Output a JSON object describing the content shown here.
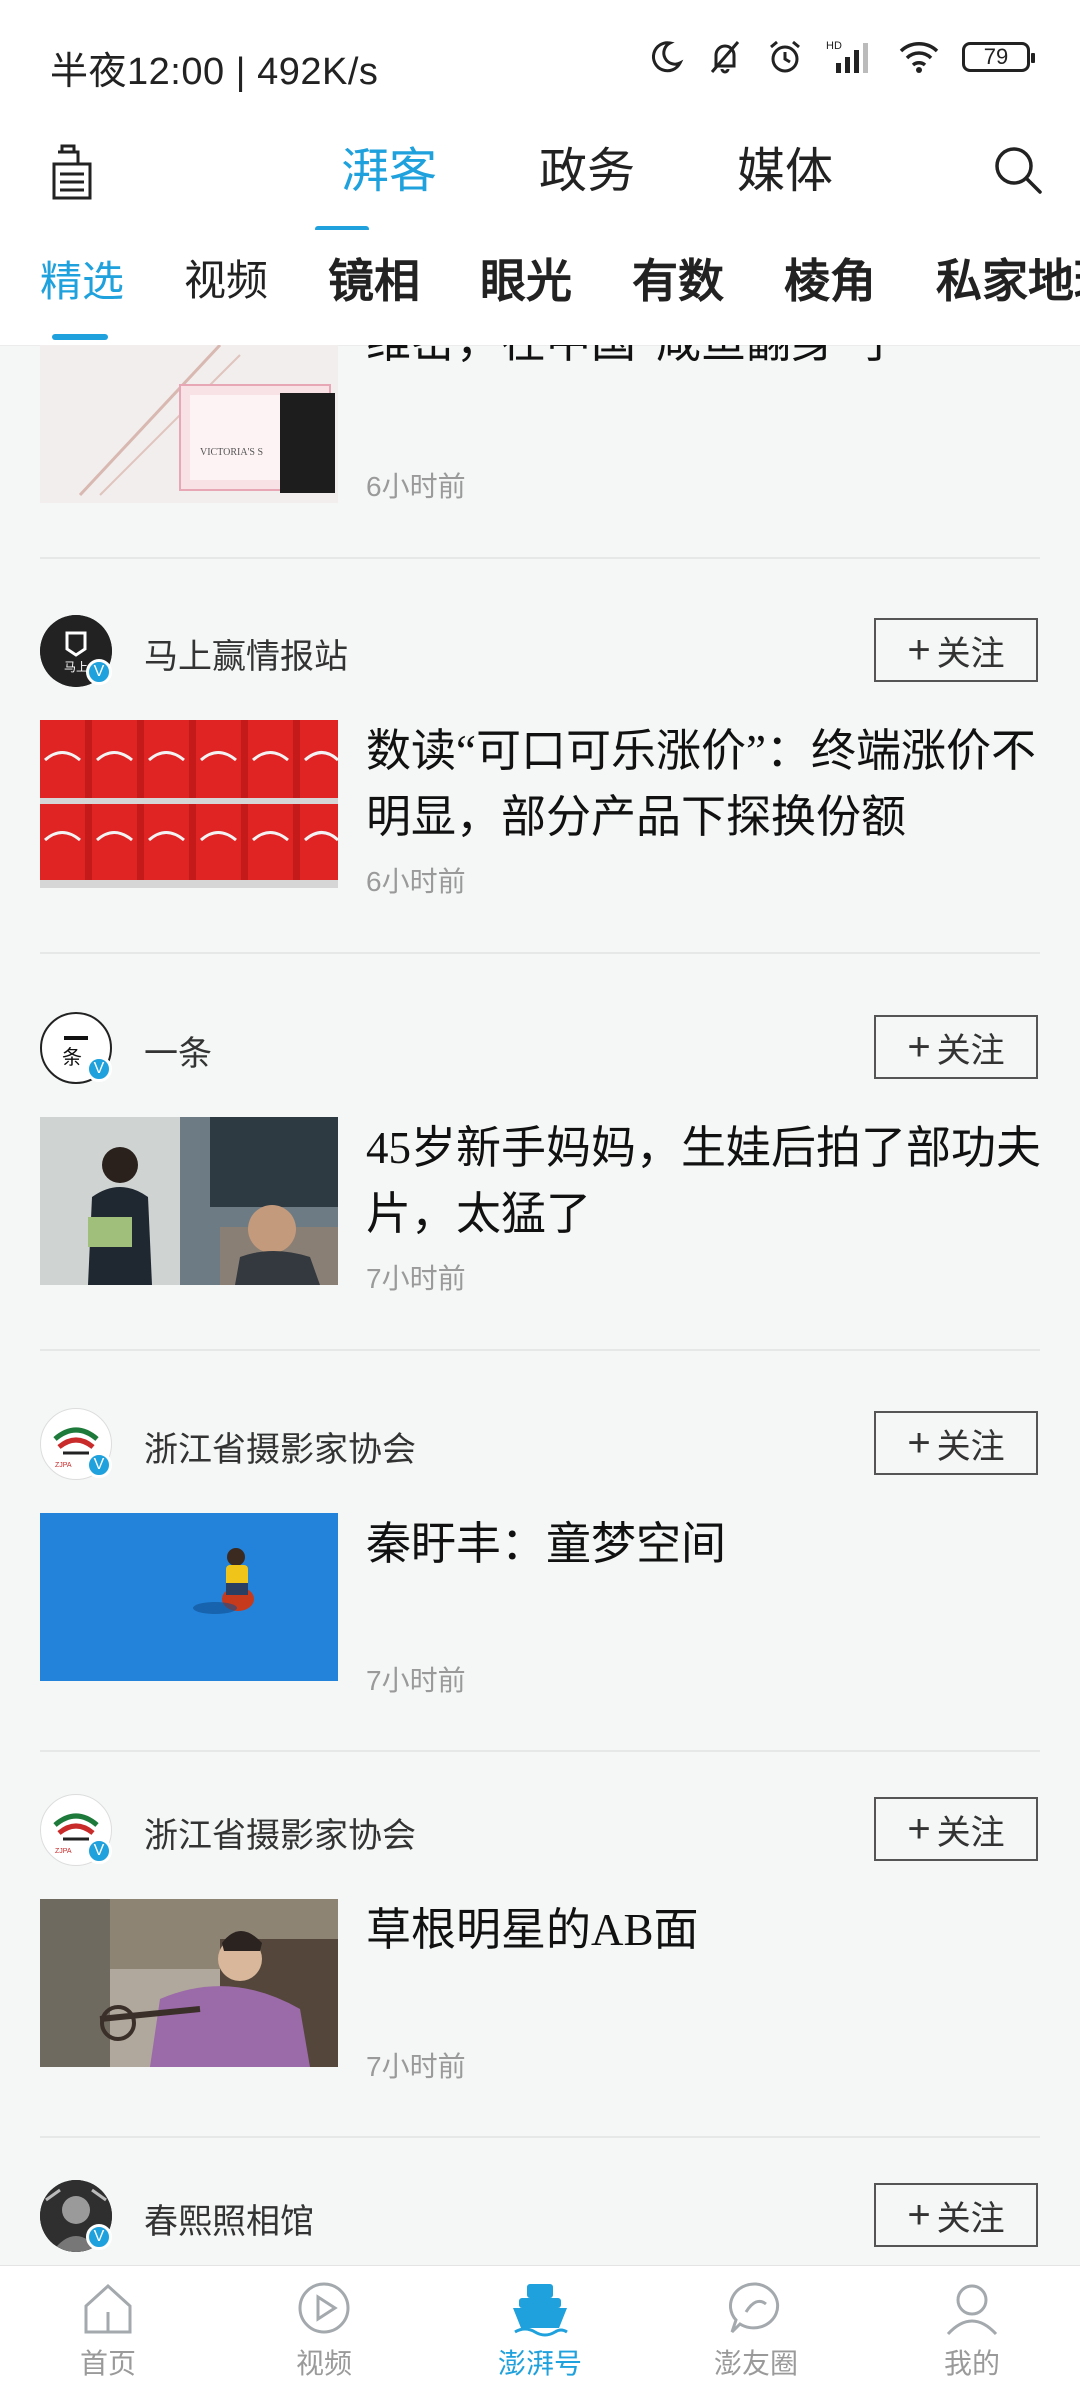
{
  "status_bar": {
    "time": "半夜12:00 | 492K/s",
    "battery": "79",
    "icons": [
      "moon-icon",
      "bell-mute-icon",
      "alarm-icon",
      "signal-hd-icon",
      "wifi-icon",
      "battery-icon"
    ]
  },
  "top_nav": {
    "tabs": [
      {
        "label": "湃客",
        "active": true
      },
      {
        "label": "政务",
        "active": false
      },
      {
        "label": "媒体",
        "active": false
      }
    ]
  },
  "sub_nav": {
    "items": [
      {
        "label": "精选",
        "active": true
      },
      {
        "label": "视频"
      },
      {
        "label": "镜相"
      },
      {
        "label": "眼光"
      },
      {
        "label": "有数"
      },
      {
        "label": "棱角"
      },
      {
        "label": "私家地理"
      }
    ]
  },
  "feed": {
    "follow_label": "关注",
    "items": [
      {
        "title": "维密，在中国“咸鱼翻身”了",
        "time": "6小时前"
      },
      {
        "author": "马上赢情报站",
        "title": "数读“可口可乐涨价”：终端涨价不明显，部分产品下探换份额",
        "time": "6小时前"
      },
      {
        "author": "一条",
        "title": "45岁新手妈妈，生娃后拍了部功夫片，太猛了",
        "time": "7小时前"
      },
      {
        "author": "浙江省摄影家协会",
        "title": "秦盱丰：童梦空间",
        "time": "7小时前"
      },
      {
        "author": "浙江省摄影家协会",
        "title": "草根明星的AB面",
        "time": "7小时前"
      },
      {
        "author": "春熙照相馆"
      }
    ]
  },
  "bottom_nav": {
    "items": [
      {
        "label": "首页",
        "icon": "home-icon"
      },
      {
        "label": "视频",
        "icon": "play-icon"
      },
      {
        "label": "澎湃号",
        "icon": "boat-icon",
        "active": true
      },
      {
        "label": "澎友圈",
        "icon": "chat-icon"
      },
      {
        "label": "我的",
        "icon": "user-icon"
      }
    ]
  },
  "colors": {
    "accent": "#1ea1dc",
    "background": "#f5f7f7",
    "text_secondary": "#9a9a9a"
  }
}
